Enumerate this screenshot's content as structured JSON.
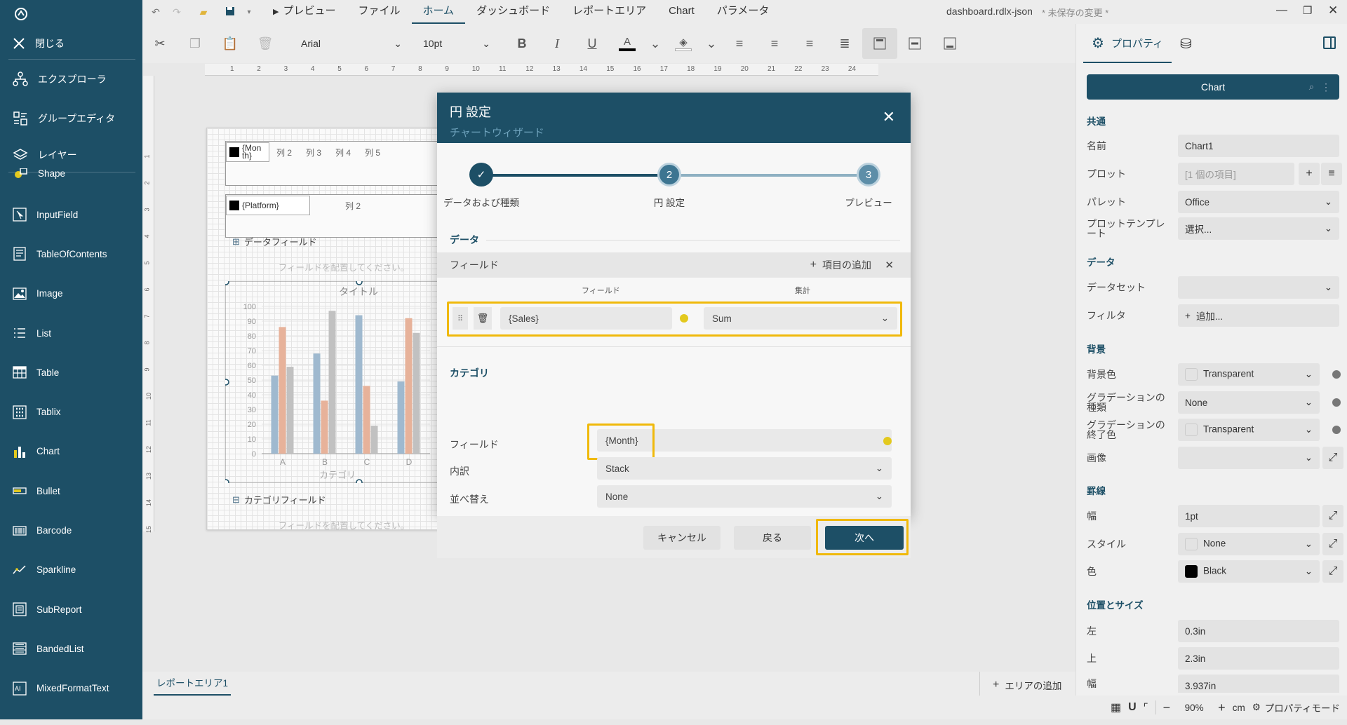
{
  "app": {
    "menus": [
      "プレビュー",
      "ファイル",
      "ホーム",
      "ダッシュボード",
      "レポートエリア",
      "Chart",
      "パラメータ"
    ],
    "active_menu": "ホーム",
    "file_name": "dashboard.rdlx-json",
    "unsaved": "* 未保存の変更 *"
  },
  "sidebar": {
    "close_label": "閉じる",
    "nav": [
      "エクスプローラ",
      "グループエディタ",
      "レイヤー"
    ],
    "tools": [
      "Shape",
      "InputField",
      "TableOfContents",
      "Image",
      "List",
      "Table",
      "Tablix",
      "Chart",
      "Bullet",
      "Barcode",
      "Sparkline",
      "SubReport",
      "BandedList",
      "MixedFormatText"
    ]
  },
  "toolbar": {
    "font_family": "Arial",
    "font_size": "10pt",
    "bold": "B",
    "italic": "I",
    "underline": "U",
    "font_color_glyph": "A"
  },
  "ruler": [
    "1",
    "2",
    "3",
    "4",
    "5",
    "6",
    "7",
    "8",
    "9",
    "10",
    "11",
    "12",
    "13",
    "14",
    "15",
    "16",
    "17",
    "18",
    "19",
    "20",
    "21",
    "22",
    "23",
    "24"
  ],
  "vruler": [
    "1",
    "2",
    "3",
    "4",
    "5",
    "6",
    "7",
    "8",
    "9",
    "10",
    "11",
    "12",
    "13",
    "14",
    "15"
  ],
  "canvas": {
    "table1_cells": [
      "{Mon th}",
      "列 2",
      "列 3",
      "列 4",
      "列 5"
    ],
    "table2_cells": [
      "{Platform}",
      "列 2"
    ],
    "data_field_label": "データフィールド",
    "place_field_hint": "フィールドを配置してください。",
    "category_field_label": "カテゴリフィールド",
    "place_field_hint2": "フィールドを配置してください。"
  },
  "chart_data": {
    "type": "bar",
    "title": "タイトル",
    "xlabel": "カテゴリ",
    "categories": [
      "A",
      "B",
      "C",
      "D"
    ],
    "series": [
      {
        "values": [
          53,
          68,
          94,
          49
        ],
        "color": "#9fb9cf"
      },
      {
        "values": [
          86,
          36,
          46,
          92
        ],
        "color": "#e7b29a"
      },
      {
        "values": [
          59,
          97,
          19,
          82
        ],
        "color": "#c1c1c1"
      }
    ],
    "yticks": [
      "0",
      "10",
      "20",
      "30",
      "40",
      "50",
      "60",
      "70",
      "80",
      "90",
      "100"
    ],
    "ylim": [
      0,
      100
    ]
  },
  "modal": {
    "title": "円 設定",
    "subtitle": "チャートウィザード",
    "steps": [
      {
        "label": "データおよび種類",
        "badge": "✓"
      },
      {
        "label": "円 設定",
        "badge": "2"
      },
      {
        "label": "プレビュー",
        "badge": "3"
      }
    ],
    "data_section": "データ",
    "field_header": "フィールド",
    "add_item": "項目の追加",
    "col_field": "フィールド",
    "col_aggregate": "集計",
    "value_field": "{Sales}",
    "aggregate": "Sum",
    "category_section": "カテゴリ",
    "category_field_label": "フィールド",
    "category_field": "{Month}",
    "breakdown_label": "内訳",
    "breakdown": "Stack",
    "sort_label": "並べ替え",
    "sort": "None",
    "cancel": "キャンセル",
    "back": "戻る",
    "next": "次へ"
  },
  "properties": {
    "tab_properties": "プロパティ",
    "selected": "Chart",
    "sec_common": "共通",
    "name_label": "名前",
    "name": "Chart1",
    "plot_label": "プロット",
    "plot": "[1 個の項目]",
    "palette_label": "パレット",
    "palette": "Office",
    "plot_template_label": "プロットテンプレート",
    "plot_template": "選択...",
    "sec_data": "データ",
    "dataset_label": "データセット",
    "dataset": "",
    "filter_label": "フィルタ",
    "filter_add": "追加...",
    "sec_background": "背景",
    "bgcolor_label": "背景色",
    "bgcolor": "Transparent",
    "gradient_type_label": "グラデーションの種類",
    "gradient_type": "None",
    "gradient_end_label": "グラデーションの終了色",
    "gradient_end": "Transparent",
    "image_label": "画像",
    "image": "",
    "sec_border": "罫線",
    "width_label": "幅",
    "width": "1pt",
    "style_label": "スタイル",
    "style": "None",
    "color_label": "色",
    "color": "Black",
    "sec_position": "位置とサイズ",
    "left_label": "左",
    "left": "0.3in",
    "top_label": "上",
    "top": "2.3in",
    "size_width_label": "幅",
    "size_width": "3.937in"
  },
  "bottom": {
    "area_tab": "レポートエリア1",
    "add_area": "エリアの追加"
  },
  "status": {
    "zoom": "90%",
    "unit": "cm",
    "mode": "プロパティモード"
  },
  "colors": {
    "primary": "#1d4f66",
    "highlight": "#f0b90b"
  }
}
